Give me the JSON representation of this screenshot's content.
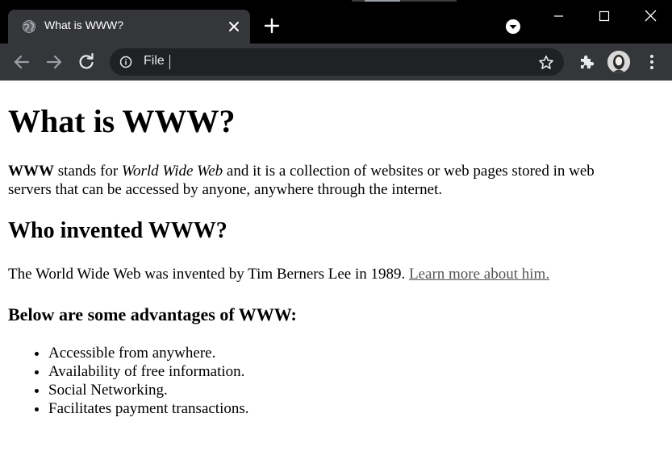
{
  "browser": {
    "tab": {
      "title": "What is WWW?"
    },
    "address_bar": {
      "scheme_label": "File",
      "value": ""
    },
    "colors": {
      "tabstrip": "#000000",
      "toolbar": "#35363a",
      "omnibox": "#202124",
      "icon": "#e8eaed"
    }
  },
  "page": {
    "title": "What is WWW?",
    "intro": {
      "term": "WWW",
      "text1": " stands for ",
      "italic": "World Wide Web",
      "text2": " and it is a collection of websites or web pages stored in web servers that can be accessed by anyone, anywhere through the internet."
    },
    "section_heading": "Who invented WWW?",
    "inventor_text": "The World Wide Web was invented by Tim Berners Lee in 1989. ",
    "inventor_link": "Learn more about him.",
    "advantages_heading": "Below are some advantages of WWW:",
    "advantages": [
      "Accessible from anywhere.",
      "Availability of free information.",
      "Social Networking.",
      "Facilitates payment transactions."
    ]
  }
}
